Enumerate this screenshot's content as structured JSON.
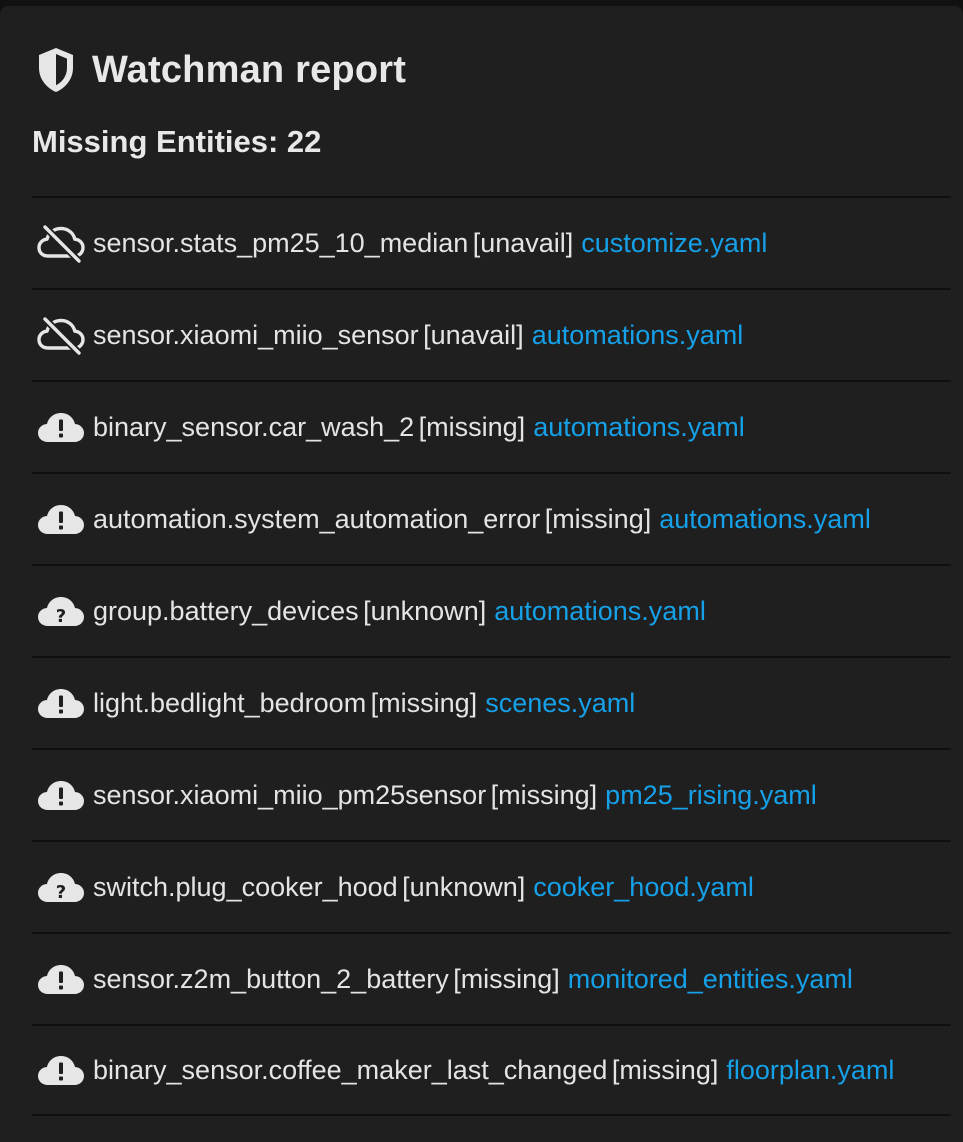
{
  "header": {
    "title": "Watchman report",
    "icon": "shield-half-icon"
  },
  "summary": {
    "text": "Missing Entities: 22"
  },
  "colors": {
    "card_background": "#1f1f1f",
    "text": "#e4e4e4",
    "link": "#15a0e8",
    "divider": "#0f0f0f"
  },
  "rows": [
    {
      "icon": "cloud-off-icon",
      "entity": "sensor.stats_pm25_10_median",
      "status": "[unavail]",
      "file": "customize.yaml"
    },
    {
      "icon": "cloud-off-icon",
      "entity": "sensor.xiaomi_miio_sensor",
      "status": "[unavail]",
      "file": "automations.yaml"
    },
    {
      "icon": "cloud-alert-icon",
      "entity": "binary_sensor.car_wash_2",
      "status": "[missing]",
      "file": "automations.yaml"
    },
    {
      "icon": "cloud-alert-icon",
      "entity": "automation.system_automation_error",
      "status": "[missing]",
      "file": "automations.yaml"
    },
    {
      "icon": "cloud-question-icon",
      "entity": "group.battery_devices",
      "status": "[unknown]",
      "file": "automations.yaml"
    },
    {
      "icon": "cloud-alert-icon",
      "entity": "light.bedlight_bedroom",
      "status": "[missing]",
      "file": "scenes.yaml"
    },
    {
      "icon": "cloud-alert-icon",
      "entity": "sensor.xiaomi_miio_pm25sensor",
      "status": "[missing]",
      "file": "pm25_rising.yaml"
    },
    {
      "icon": "cloud-question-icon",
      "entity": "switch.plug_cooker_hood",
      "status": "[unknown]",
      "file": "cooker_hood.yaml"
    },
    {
      "icon": "cloud-alert-icon",
      "entity": "sensor.z2m_button_2_battery",
      "status": "[missing]",
      "file": "monitored_entities.yaml"
    },
    {
      "icon": "cloud-alert-icon",
      "entity": "binary_sensor.coffee_maker_last_changed",
      "status": "[missing]",
      "file": "floorplan.yaml"
    }
  ]
}
